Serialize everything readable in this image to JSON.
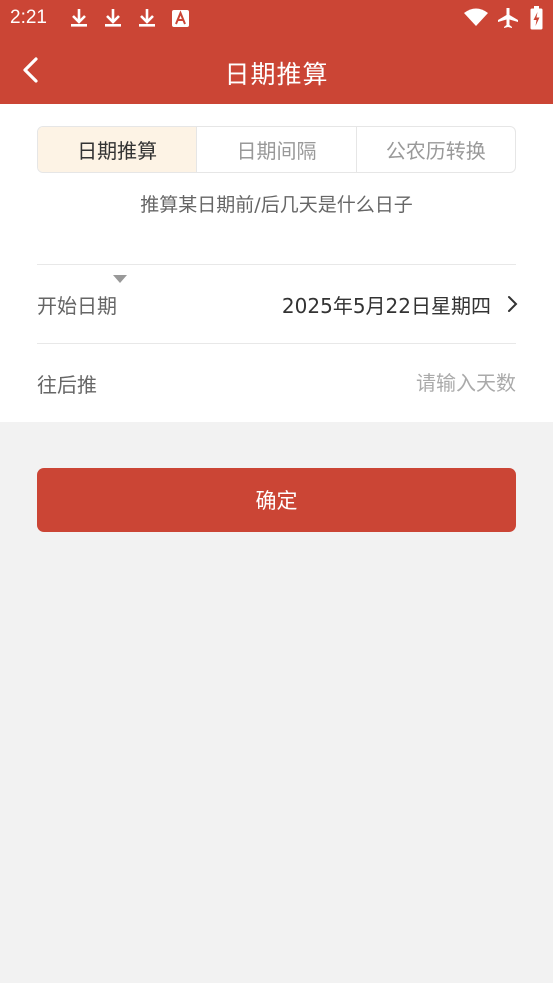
{
  "status_bar": {
    "time": "2:21",
    "icons": [
      "download-icon",
      "download-icon",
      "download-icon",
      "font-a-icon",
      "wifi-icon",
      "airplane-icon",
      "battery-charging-icon"
    ]
  },
  "app_bar": {
    "title": "日期推算",
    "back_icon": "back-arrow-icon"
  },
  "tabs": [
    {
      "label": "日期推算",
      "active": true
    },
    {
      "label": "日期间隔",
      "active": false
    },
    {
      "label": "公农历转换",
      "active": false
    }
  ],
  "subtitle": "推算某日期前/后几天是什么日子",
  "start_date": {
    "label": "开始日期",
    "value": "2025年5月22日星期四"
  },
  "direction": {
    "label": "往后推",
    "input_placeholder": "请输入天数",
    "input_value": ""
  },
  "confirm_label": "确定",
  "colors": {
    "brand_red": "#cb4535",
    "active_tab_bg": "#fdf3e5",
    "page_bg": "#f2f2f2"
  }
}
